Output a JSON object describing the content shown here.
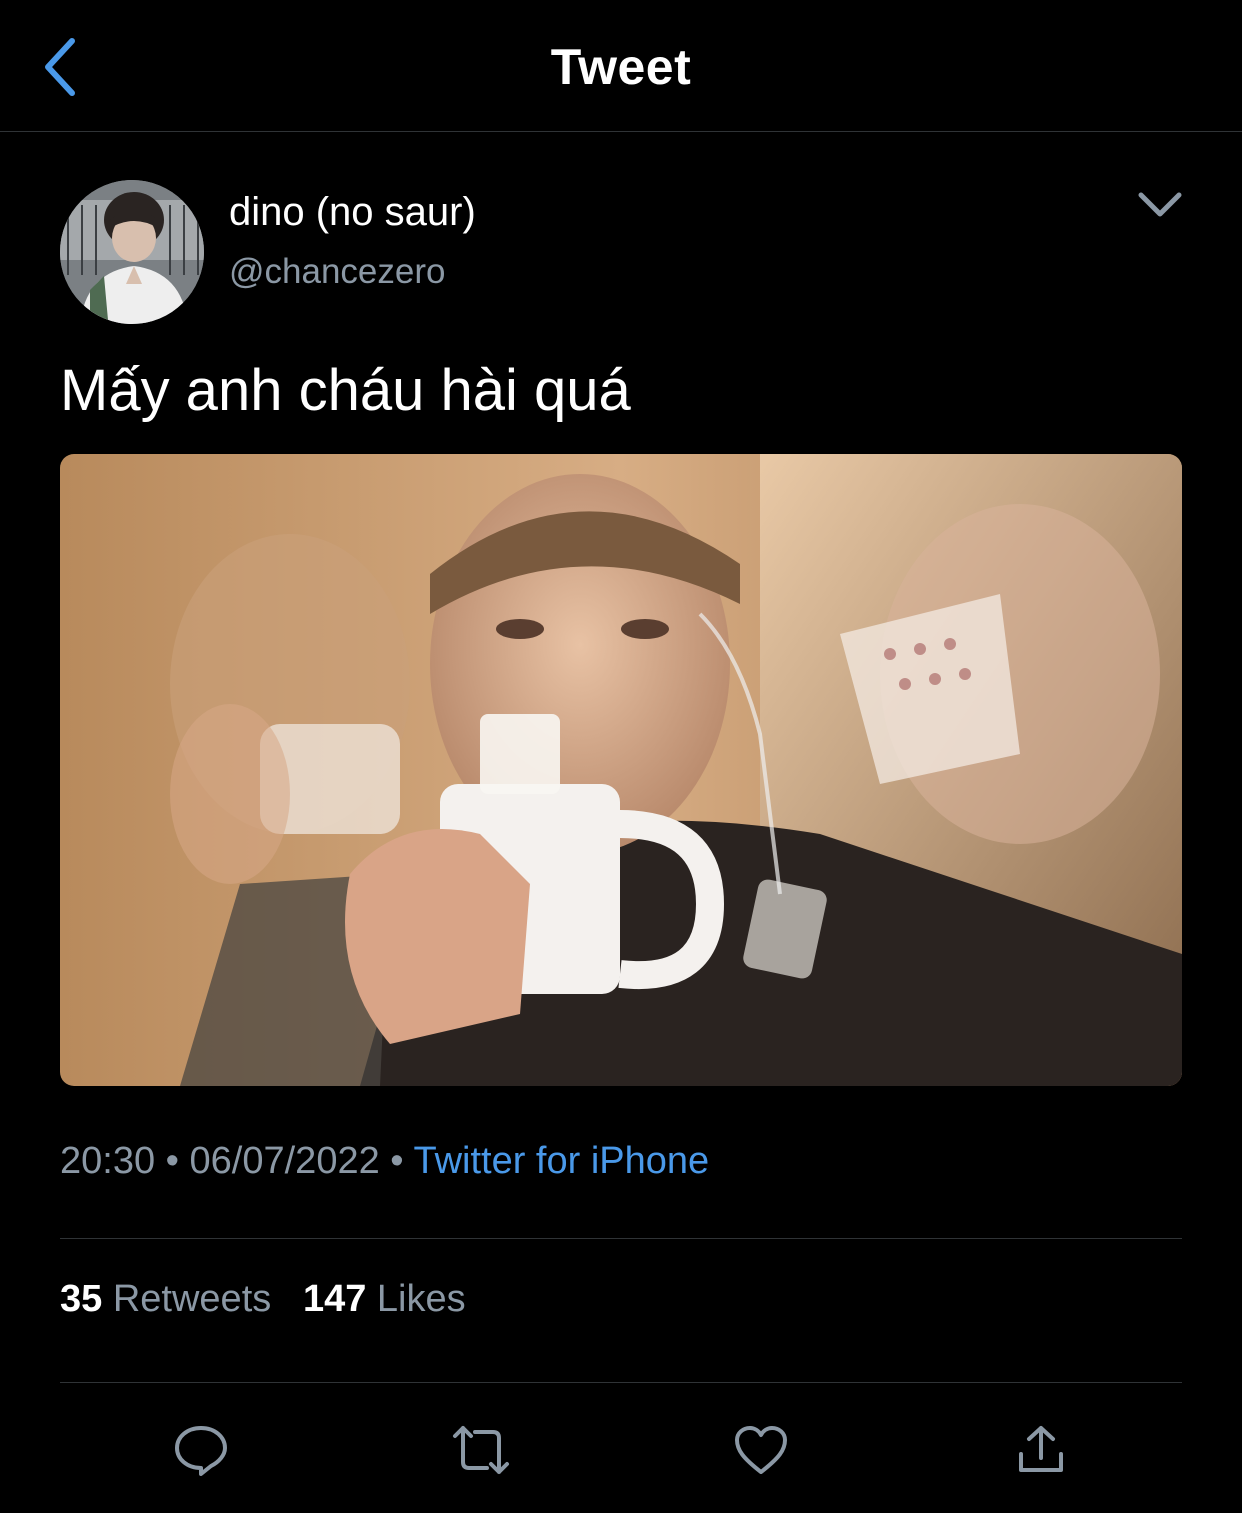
{
  "header": {
    "title": "Tweet",
    "back_icon": "chevron-left-icon",
    "accent_color": "#4a99e9"
  },
  "author": {
    "display_name": "dino (no saur)",
    "handle": "@chancezero"
  },
  "tweet": {
    "text": "Mấy anh cháu hài quá"
  },
  "meta": {
    "time": "20:30",
    "date": "06/07/2022",
    "separator": "•",
    "source": "Twitter for iPhone"
  },
  "stats": {
    "retweets_count": "35",
    "retweets_label": "Retweets",
    "likes_count": "147",
    "likes_label": "Likes"
  },
  "actions": {
    "reply_icon": "reply-icon",
    "retweet_icon": "retweet-icon",
    "like_icon": "heart-icon",
    "share_icon": "share-icon"
  }
}
